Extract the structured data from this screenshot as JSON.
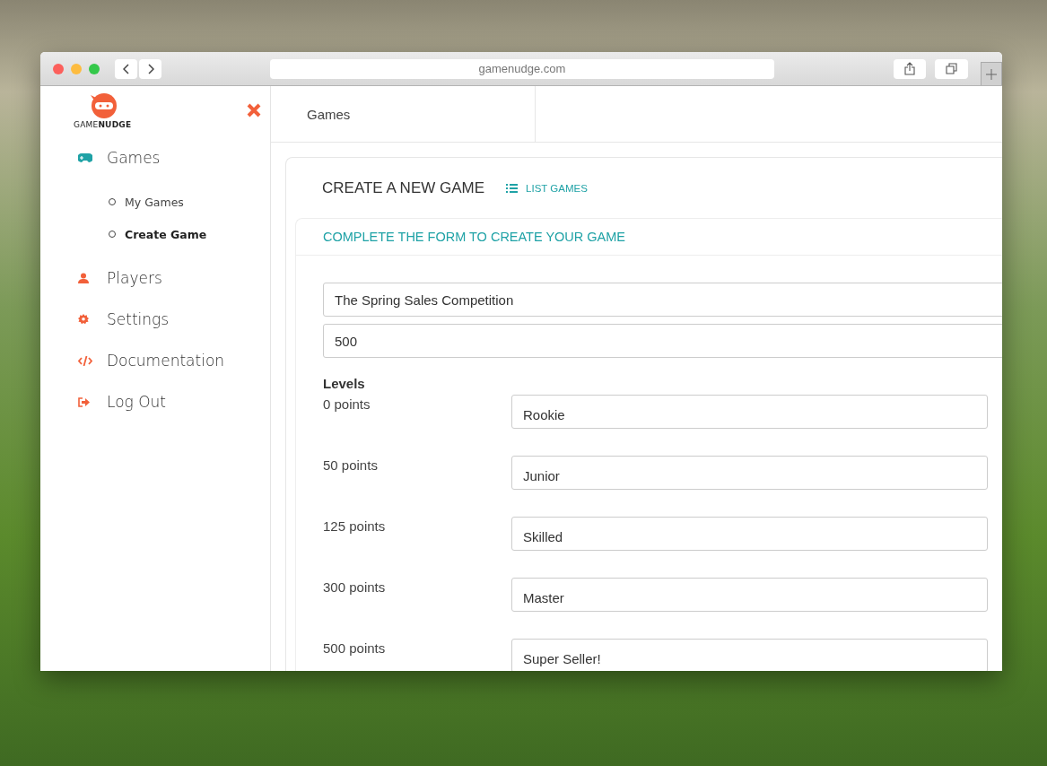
{
  "browser": {
    "url": "gamenudge.com"
  },
  "sidebar": {
    "logo": {
      "name_regular": "GAME",
      "name_bold": "NUDGE"
    },
    "items": [
      {
        "label": "Games",
        "kind": "gamepad",
        "color": "#1fa2a6",
        "children": [
          {
            "label": "My Games",
            "selected": false
          },
          {
            "label": "Create Game",
            "selected": true
          }
        ]
      },
      {
        "label": "Players",
        "kind": "user",
        "color": "#f2603a"
      },
      {
        "label": "Settings",
        "kind": "gear",
        "color": "#f2603a"
      },
      {
        "label": "Documentation",
        "kind": "code",
        "color": "#f2603a"
      },
      {
        "label": "Log Out",
        "kind": "logout",
        "color": "#f2603a"
      }
    ]
  },
  "header": {
    "tab": "Games"
  },
  "card": {
    "title": "CREATE A NEW GAME",
    "link": "LIST GAMES",
    "form_title": "COMPLETE THE FORM TO CREATE YOUR GAME",
    "fields": [
      {
        "value": "The Spring Sales Competition"
      },
      {
        "value": "500"
      }
    ],
    "levels_heading": "Levels",
    "levels": [
      {
        "points": "0 points",
        "name": "Rookie"
      },
      {
        "points": "50 points",
        "name": "Junior"
      },
      {
        "points": "125 points",
        "name": "Skilled"
      },
      {
        "points": "300 points",
        "name": "Master"
      },
      {
        "points": "500 points",
        "name": "Super Seller!"
      }
    ]
  }
}
